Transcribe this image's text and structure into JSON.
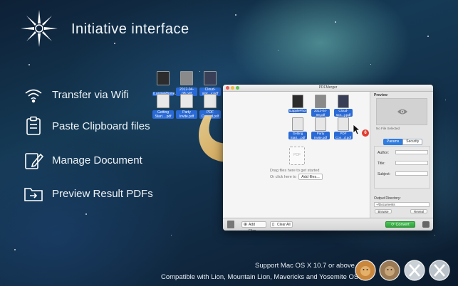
{
  "header": {
    "title": "Initiative interface",
    "logo_icon": "star-logo-icon"
  },
  "features": [
    {
      "icon": "wifi-icon",
      "label": "Transfer via Wifi"
    },
    {
      "icon": "clipboard-icon",
      "label": "Paste Clipboard files"
    },
    {
      "icon": "edit-document-icon",
      "label": "Manage Document"
    },
    {
      "icon": "preview-folder-icon",
      "label": "Preview Result PDFs"
    }
  ],
  "floating_files": [
    {
      "label": "iLapplePhone...s.pdf",
      "style": "dark"
    },
    {
      "label": "2012-04-08.pdf",
      "style": "gray"
    },
    {
      "label": "Cloud-stor...y.pdf",
      "style": "blue"
    },
    {
      "label": "Getting Start....pdf",
      "style": "light"
    },
    {
      "label": "Party Invite.pdf",
      "style": "light"
    },
    {
      "label": "PDF Con...d.pdf",
      "style": "light"
    }
  ],
  "window": {
    "title": "PDFMerger",
    "drop_files": [
      {
        "label": "iLapplePhone...s.pdf",
        "style": "dark"
      },
      {
        "label": "2012-04-08.pdf",
        "style": "gray"
      },
      {
        "label": "Cloud-stor...y.pdf",
        "style": "blue"
      },
      {
        "label": "Getting Start....pdf",
        "style": "light"
      },
      {
        "label": "Party Invite.pdf",
        "style": "light"
      },
      {
        "label": "PDF Con...d.pdf",
        "style": "light"
      }
    ],
    "badge_count": "6",
    "ghost_label": "PDF",
    "drag_text": "Drag files here to get started",
    "or_click_text": "Or click here to",
    "add_files_link": "Add files...",
    "preview_label": "Preview",
    "no_file_text": "No File Selected",
    "tabs": [
      "Params",
      "Security"
    ],
    "fields": {
      "author": "Author:",
      "title": "Title:",
      "subject": "Subject:"
    },
    "output_dir_label": "Output Directory:",
    "output_dir_value": "~/Documents",
    "browse_label": "Browse",
    "reveal_label": "Reveal",
    "bottom": {
      "add_files": "Add Files...",
      "clear_all": "Clear All",
      "convert": "Convert"
    }
  },
  "footer": {
    "support": "Support Mac OS X 10.7 or above.",
    "compatible": "Compatible with Lion, Mountain Lion, Mavericks and Yosemite OS X.",
    "os_icons": [
      "lion-icon",
      "mountain-lion-icon",
      "mavericks-x-icon",
      "yosemite-x-icon"
    ]
  },
  "colors": {
    "accent_blue": "#2a6ad6",
    "convert_green": "#3bb449",
    "arrow_gold": "#e6b45a"
  }
}
